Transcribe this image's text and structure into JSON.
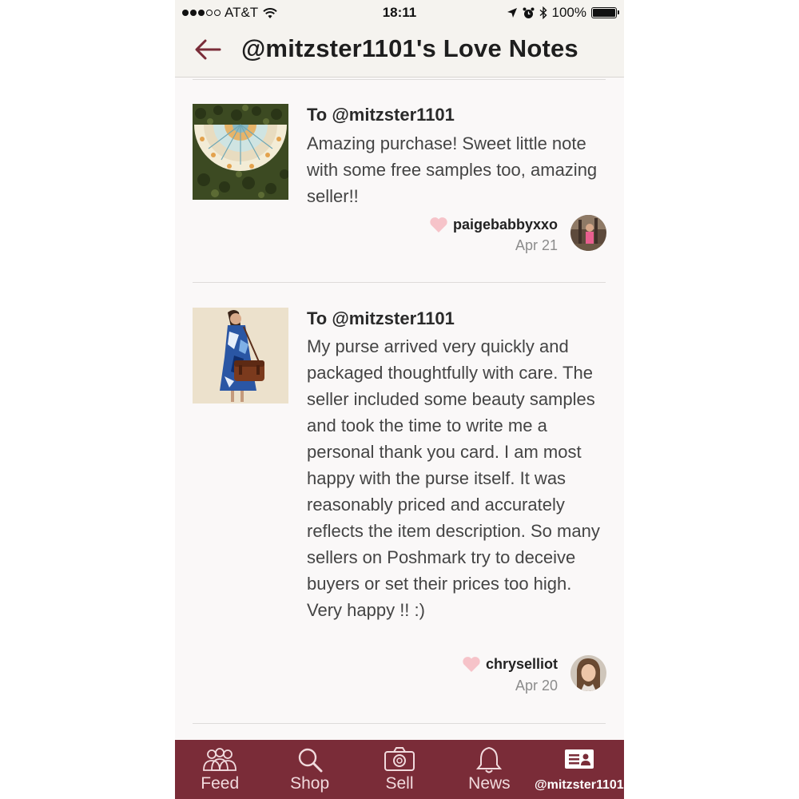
{
  "status_bar": {
    "carrier": "AT&T",
    "time": "18:11",
    "battery": "100%"
  },
  "header": {
    "title": "@mitzster1101's Love Notes",
    "back_icon": "arrow-left-icon"
  },
  "notes": [
    {
      "to": "To @mitzster1101",
      "text": "Amazing purchase! Sweet little note with some free samples too, amazing seller!!",
      "author": "paigebabbyxxo",
      "date": "Apr 21",
      "product_image": "mandala-beach-towel-thumbnail",
      "avatar": "user-avatar"
    },
    {
      "to": "To @mitzster1101",
      "text": "My purse arrived very quickly and packaged thoughtfully with care. The seller included some beauty samples and took the time to write me a personal thank you card. I am most happy with the purse itself. It was reasonably priced and accurately reflects the item description. So many sellers on Poshmark try to deceive buyers or set their prices too high. Very happy !! :)",
      "author": "chryselliot",
      "date": "Apr 20",
      "product_image": "brown-purse-thumbnail",
      "avatar": "user-avatar"
    }
  ],
  "tabs": [
    {
      "label": "Feed",
      "icon": "people-icon"
    },
    {
      "label": "Shop",
      "icon": "search-icon"
    },
    {
      "label": "Sell",
      "icon": "camera-icon"
    },
    {
      "label": "News",
      "icon": "bell-icon"
    },
    {
      "label": "@mitzster1101",
      "icon": "profile-card-icon",
      "active": true
    }
  ],
  "colors": {
    "accent": "#7a2c38",
    "heart": "#f6c3c9",
    "header_bg": "#f5f3ef"
  }
}
